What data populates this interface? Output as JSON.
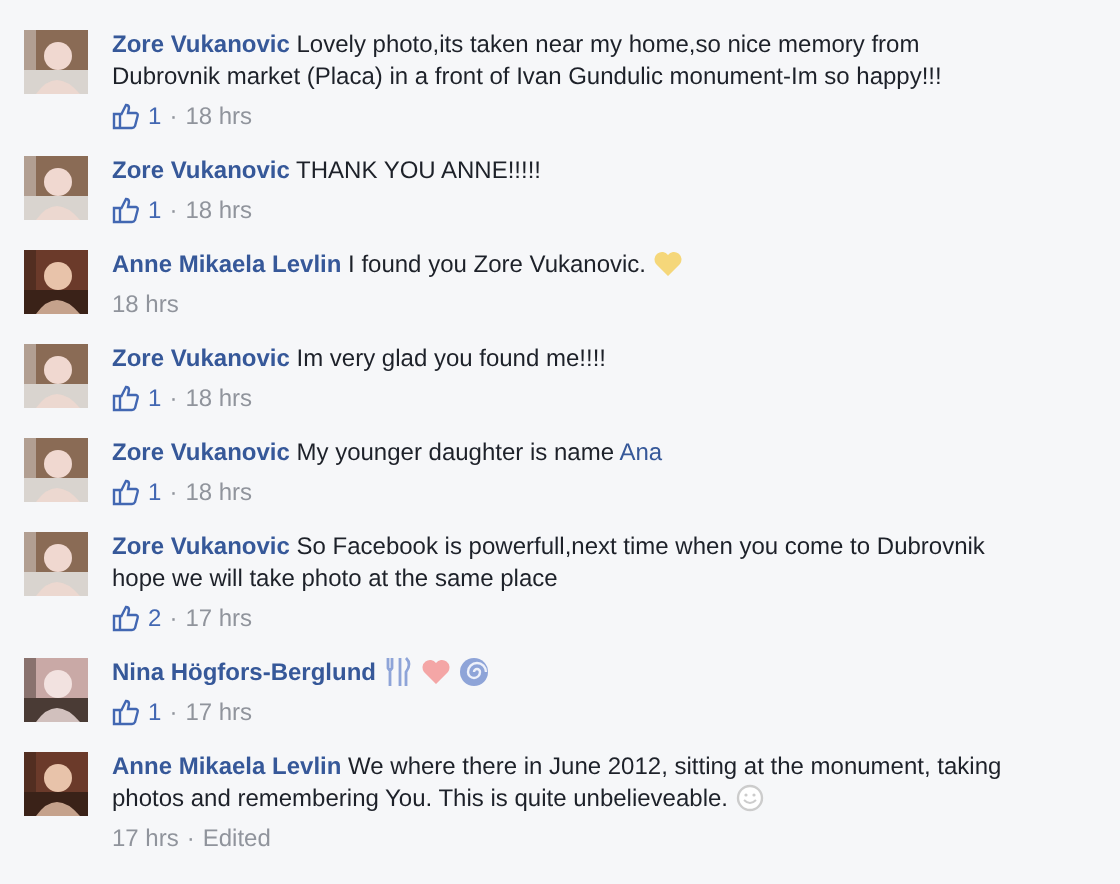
{
  "comments": [
    {
      "author": "Zore Vukanovic",
      "text": "Lovely photo,its taken near my home,so nice memory from Dubrovnik market (Placa) in a front of Ivan Gundulic monument-Im so happy!!!",
      "likes": "1",
      "dot": "·",
      "time": "18 hrs"
    },
    {
      "author": "Zore Vukanovic",
      "text": "THANK YOU ANNE!!!!!",
      "likes": "1",
      "dot": "·",
      "time": "18 hrs"
    },
    {
      "author": "Anne Mikaela Levlin",
      "text": "I found you Zore Vukanovic.",
      "icons": [
        {
          "kind": "heart",
          "color": "#f5d77a"
        }
      ],
      "time": "18 hrs"
    },
    {
      "author": "Zore Vukanovic",
      "text": "Im very glad you found me!!!!",
      "likes": "1",
      "dot": "·",
      "time": "18 hrs"
    },
    {
      "author": "Zore Vukanovic",
      "text": "My younger daughter is name",
      "link": "Ana",
      "likes": "1",
      "dot": "·",
      "time": "18 hrs"
    },
    {
      "author": "Zore Vukanovic",
      "text": "So Facebook is powerfull,next time when you come to Dubrovnik hope we will take photo at the same place",
      "likes": "2",
      "dot": "·",
      "time": "17 hrs"
    },
    {
      "author": "Nina Högfors-Berglund",
      "icons": [
        {
          "kind": "utensils",
          "color": "#8ea4d8"
        },
        {
          "kind": "heart",
          "color": "#f4a6a6"
        },
        {
          "kind": "spiral",
          "color": "#8ea4d8"
        }
      ],
      "likes": "1",
      "dot": "·",
      "time": "17 hrs"
    },
    {
      "author": "Anne Mikaela Levlin",
      "text": "We where there in June 2012, sitting at the monument, taking photos and remembering You. This is quite unbelieveable.",
      "icons": [
        {
          "kind": "smiley",
          "color": "#cccccc"
        }
      ],
      "time": "17 hrs",
      "dot": "·",
      "edited": "Edited"
    }
  ]
}
